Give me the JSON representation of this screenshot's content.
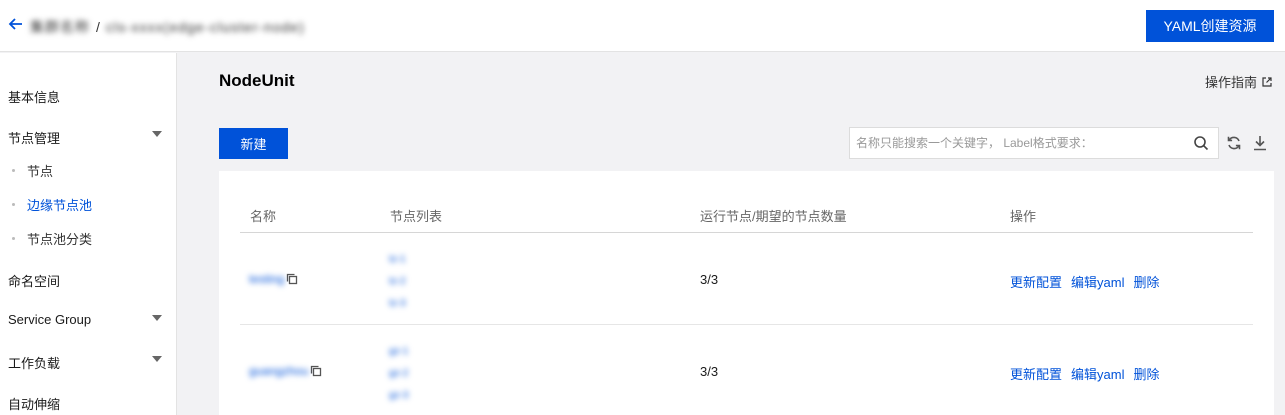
{
  "topbar": {
    "breadcrumb_parent": "集群名称",
    "breadcrumb_sep": "/",
    "breadcrumb_current": "cls-xxxx(edge-cluster-node)",
    "yaml_button": "YAML创建资源"
  },
  "sidebar": {
    "basic_info": "基本信息",
    "node_mgmt": "节点管理",
    "node_sub": [
      "节点",
      "边缘节点池",
      "节点池分类"
    ],
    "namespace": "命名空间",
    "service_group": "Service Group",
    "workload": "工作负载",
    "autoscale": "自动伸缩"
  },
  "main": {
    "title": "NodeUnit",
    "guide": "操作指南",
    "new_button": "新建",
    "search_placeholder": "名称只能搜索一个关键字， Label格式要求：",
    "columns": [
      "名称",
      "节点列表",
      "运行节点/期望的节点数量",
      "操作"
    ],
    "rows": [
      {
        "name": "testing",
        "nodes": [
          "tz-1",
          "tz-2",
          "tz-3"
        ],
        "count": "3/3",
        "actions": [
          "更新配置",
          "编辑yaml",
          "删除"
        ]
      },
      {
        "name": "guangzhou",
        "nodes": [
          "gz-1",
          "gz-2",
          "gz-3"
        ],
        "count": "3/3",
        "actions": [
          "更新配置",
          "编辑yaml",
          "删除"
        ]
      }
    ]
  },
  "colors": {
    "primary": "#0052d9"
  }
}
